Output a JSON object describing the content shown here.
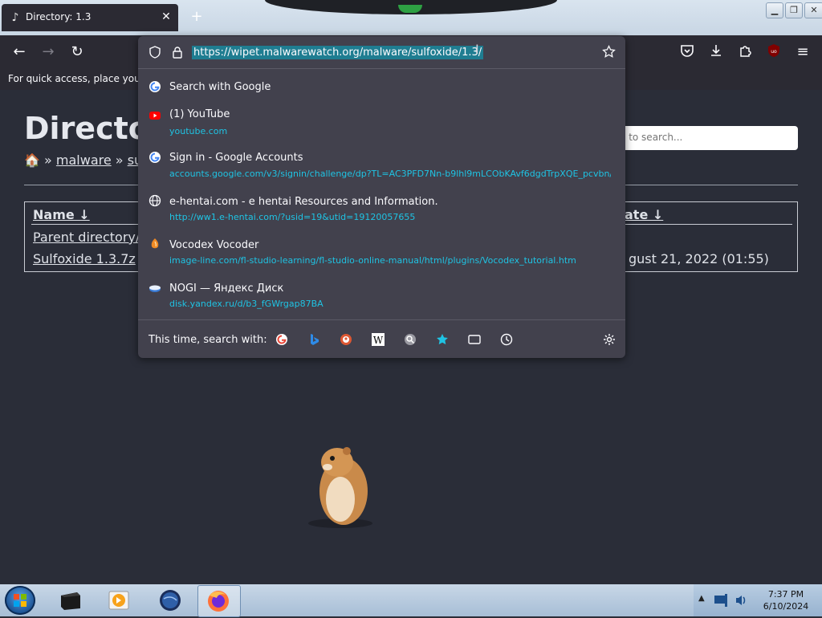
{
  "browser": {
    "tab_title": "Directory: 1.3",
    "url": "https://wipet.malwarewatch.org/malware/sulfoxide/1.3/",
    "bookmarks_hint": "For quick access, place your bo",
    "new_tab": "+",
    "tab_close": "✕"
  },
  "page": {
    "heading": "Directo",
    "breadcrumb": {
      "home": "🏠",
      "sep1": "»",
      "item1": "malware",
      "sep2": "»",
      "item2": "sulf"
    },
    "search_placeholder": "e to search...",
    "table": {
      "col_name": "Name ↓",
      "col_date": "ate ↓",
      "rows": [
        {
          "name": "Parent directory/",
          "date": ""
        },
        {
          "name": "Sulfoxide 1.3.7z",
          "date": "gust 21, 2022 (01:55)"
        }
      ]
    }
  },
  "dropdown": {
    "search_with_google": "Search with Google",
    "items": [
      {
        "title": "(1) YouTube",
        "url": "youtube.com",
        "icon": "youtube-icon"
      },
      {
        "title": "Sign in - Google Accounts",
        "url": "accounts.google.com/v3/signin/challenge/dp?TL=AC3PFD7Nn-b9lhl9mLCObKAvf6dgdTrpXQE_pcvbn/",
        "icon": "google-icon"
      },
      {
        "title": "e-hentai.com - e hentai Resources and Information.",
        "url": "http://ww1.e-hentai.com/?usid=19&utid=19120057655",
        "icon": "globe-icon"
      },
      {
        "title": "Vocodex Vocoder",
        "url": "image-line.com/fl-studio-learning/fl-studio-online-manual/html/plugins/Vocodex_tutorial.htm",
        "icon": "fl-studio-icon"
      },
      {
        "title": "NOGI — Яндекс Диск",
        "url": "disk.yandex.ru/d/b3_fGWrgap87BA",
        "icon": "yandex-disk-icon"
      }
    ],
    "search_with_label": "This time, search with:"
  },
  "taskbar": {
    "time": "7:37 PM",
    "date": "6/10/2024"
  }
}
